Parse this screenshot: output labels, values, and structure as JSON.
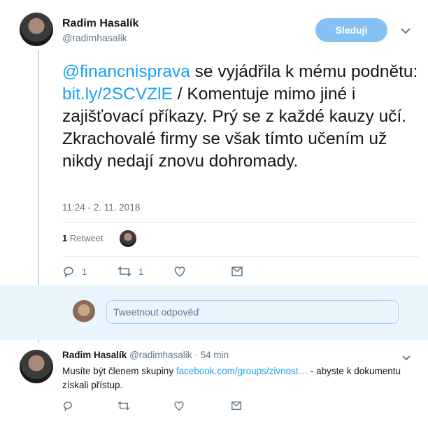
{
  "tweet": {
    "author_name": "Radim Hasalík",
    "author_handle": "@radimhasalik",
    "follow_label": "Sleduji",
    "mention": "@financnisprava",
    "text_part1": " se vyjádřila k mému podnětu: ",
    "link": "bit.ly/2SCVZlE",
    "text_part2": " / Komentuje mimo jiné i zajišťovací příkazy. Prý se z každé kauzy učí. Zkrachovalé firmy se však tímto učením už nikdy nedají znovu dohromady.",
    "timestamp": "11:24 - 2. 11. 2018",
    "retweet_count": "1",
    "retweet_label": "Retweet",
    "reply_count": "1",
    "retweet_action_count": "1"
  },
  "reply_box": {
    "placeholder": "Tweetnout odpověď"
  },
  "reply": {
    "author_name": "Radim Hasalík",
    "author_handle": "@radimhasalik",
    "time": "· 54 min",
    "text_part1": "Musíte být členem skupiny ",
    "link": "facebook.com/groups/zivnost…",
    "text_part2": " - abyste k dokumentu získali přístup."
  },
  "icons": [
    "reply-icon",
    "retweet-icon",
    "like-icon",
    "message-icon",
    "chevron-down-icon"
  ]
}
